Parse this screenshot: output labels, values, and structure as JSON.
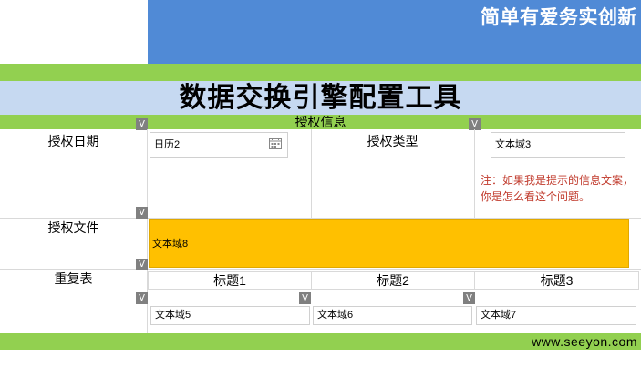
{
  "header": {
    "slogan": "简单有爱务实创新"
  },
  "title": "数据交换引擎配置工具",
  "section": {
    "title": "授权信息",
    "toggle": "V"
  },
  "rows": {
    "auth_date": {
      "label": "授权日期",
      "field_value": "日历2",
      "calendar_icon": "calendar-icon"
    },
    "auth_type": {
      "label": "授权类型",
      "field_value": "文本域3",
      "note": "注：如果我是提示的信息文案，你是怎么看这个问题。"
    },
    "auth_file": {
      "label": "授权文件",
      "field_value": "文本域8"
    },
    "repeat_table": {
      "label": "重复表",
      "columns": [
        "标题1",
        "标题2",
        "标题3"
      ],
      "cells": [
        "文本域5",
        "文本域6",
        "文本域7"
      ]
    }
  },
  "footer": {
    "url": "www.seeyon.com"
  },
  "colors": {
    "header_blue": "#508ad6",
    "green": "#92d050",
    "title_band": "#c6d9f1",
    "orange": "#ffc000",
    "note_red": "#c0392b"
  }
}
